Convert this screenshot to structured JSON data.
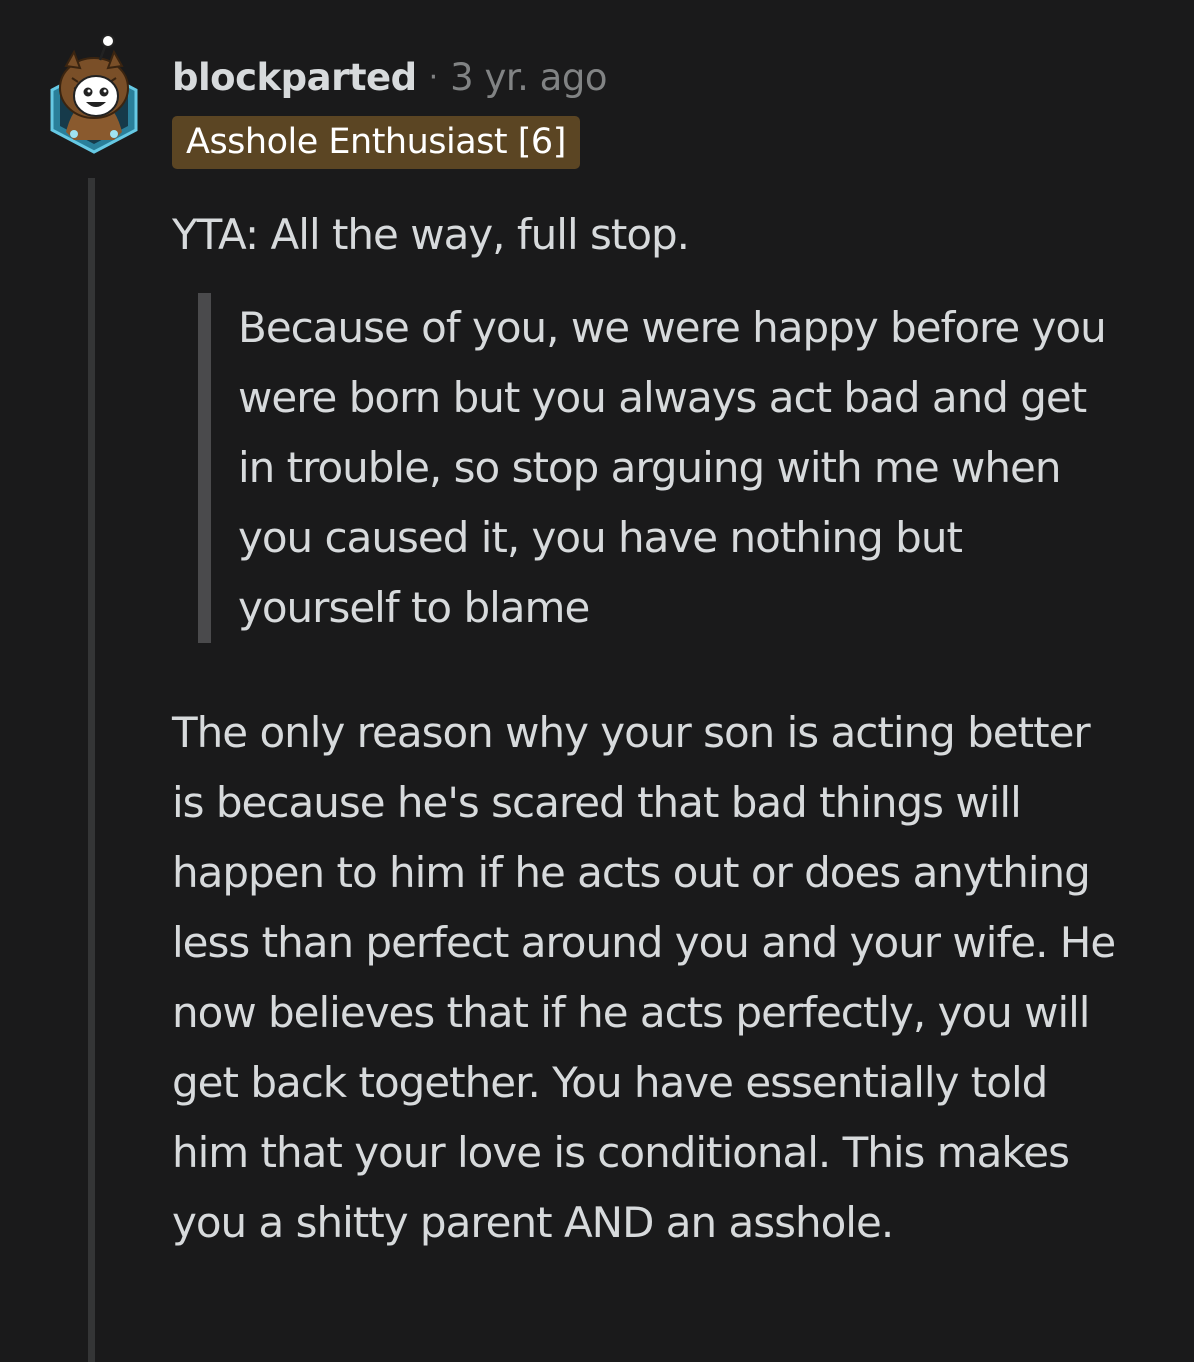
{
  "comment": {
    "author": "blockparted",
    "separator": "·",
    "timestamp": "3 yr. ago",
    "flair": "Asshole Enthusiast [6]",
    "avatar_icon": "owl-hood-snoo-avatar",
    "body": {
      "opening": "YTA: All the way, full stop.",
      "quote": "Because of you, we were happy before you were born but you always act bad and get in trouble, so stop arguing with me when you caused it, you have nothing but yourself to blame",
      "reply": "The only reason why your son is acting better is because he's scared that bad things will happen to him if he acts out or does anything less than perfect around you and your wife. He now believes that if he acts perfectly, you will get back together. You have essentially told him that your love is conditional. This makes you a shitty parent AND an asshole."
    },
    "colors": {
      "background": "#1a1a1b",
      "text": "#d7dadc",
      "meta": "#818384",
      "flair_bg": "#5b4523",
      "thread_line": "#343536",
      "quote_bar": "#4a4a4c"
    }
  }
}
